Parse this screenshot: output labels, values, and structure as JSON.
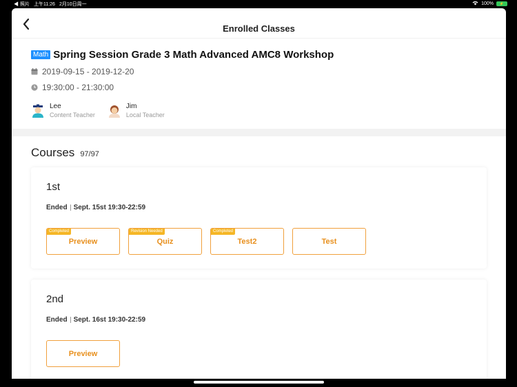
{
  "statusbar": {
    "back_app": "◀ 照片",
    "time": "上午11:26",
    "date": "2月10日周一",
    "battery_text": "100%",
    "battery_icon": "battery-charging-icon",
    "wifi_icon": "wifi-icon"
  },
  "nav": {
    "title": "Enrolled Classes",
    "back_icon": "chevron-left-icon"
  },
  "class": {
    "subject": "Math",
    "title": "Spring Session Grade 3 Math Advanced AMC8 Workshop",
    "date_range": "2019-09-15 - 2019-12-20",
    "time_range": "19:30:00 - 21:30:00",
    "teachers": [
      {
        "name": "Lee",
        "role": "Content Teacher"
      },
      {
        "name": "Jim",
        "role": "Local Teacher"
      }
    ]
  },
  "courses": {
    "title": "Courses",
    "count": "97/97",
    "lessons": [
      {
        "label": "1st",
        "status": "Ended",
        "schedule": "Sept. 15st 19:30-22:59",
        "buttons": [
          {
            "label": "Preview",
            "badge": "Completed"
          },
          {
            "label": "Quiz",
            "badge": "Revision Needed"
          },
          {
            "label": "Test2",
            "badge": "Completed"
          },
          {
            "label": "Test",
            "badge": ""
          }
        ]
      },
      {
        "label": "2nd",
        "status": "Ended",
        "schedule": "Sept. 16st 19:30-22:59",
        "buttons": [
          {
            "label": "Preview",
            "badge": ""
          }
        ]
      }
    ]
  },
  "colors": {
    "accent_orange": "#e8901e",
    "badge_yellow": "#f5b625",
    "subject_blue": "#1e90ff"
  }
}
